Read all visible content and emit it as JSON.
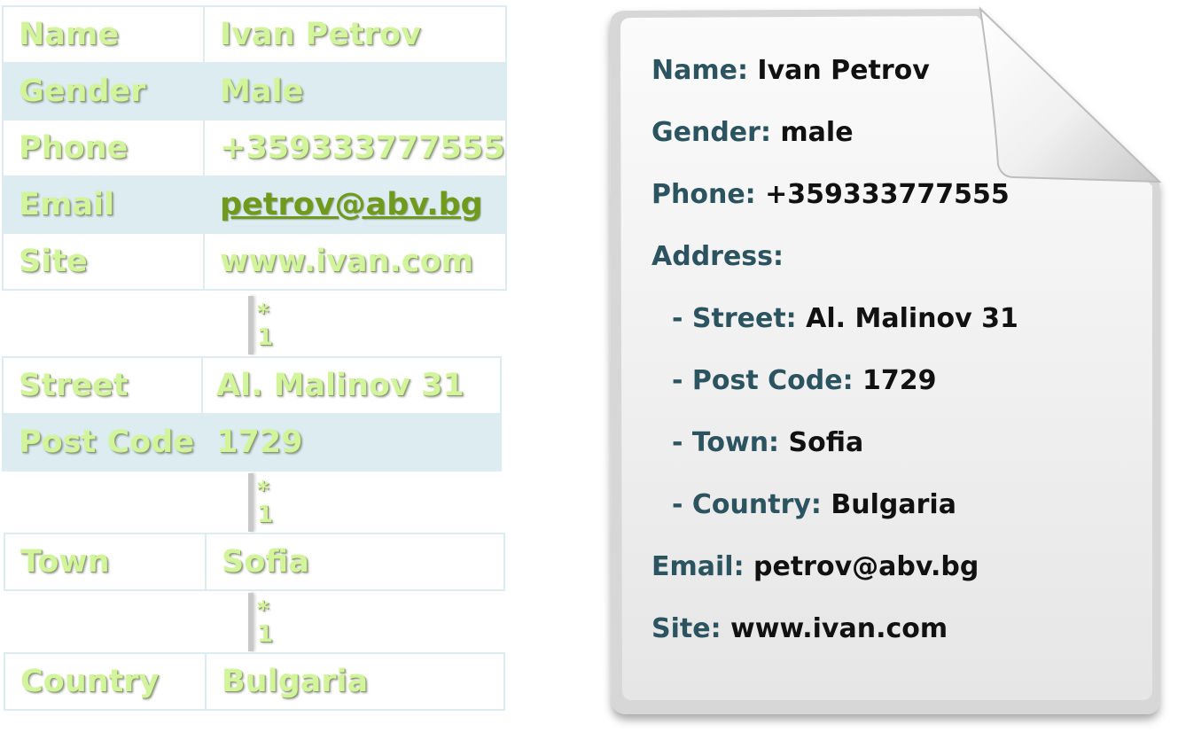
{
  "person": {
    "rows": [
      {
        "key": "Name",
        "value": "Ivan Petrov"
      },
      {
        "key": "Gender",
        "value": "Male"
      },
      {
        "key": "Phone",
        "value": "+359333777555"
      },
      {
        "key": "Email",
        "value": "petrov@abv.bg"
      },
      {
        "key": "Site",
        "value": "www.ivan.com"
      }
    ]
  },
  "address": {
    "rows": [
      {
        "key": "Street",
        "value": "Al. Malinov 31"
      },
      {
        "key": "Post Code",
        "value": "1729"
      }
    ]
  },
  "town": {
    "key": "Town",
    "value": "Sofia"
  },
  "country": {
    "key": "Country",
    "value": "Bulgaria"
  },
  "relations": {
    "many": "*",
    "one": "1"
  },
  "document": {
    "name_label": "Name:",
    "name_value": "Ivan Petrov",
    "gender_label": "Gender:",
    "gender_value": "male",
    "phone_label": "Phone:",
    "phone_value": "+359333777555",
    "address_label": "Address:",
    "street_label": "- Street:",
    "street_value": "Al. Malinov 31",
    "postcode_label": "- Post Code:",
    "postcode_value": "1729",
    "town_label": "- Town:",
    "town_value": "Sofia",
    "country_label": "- Country:",
    "country_value": "Bulgaria",
    "email_label": "Email:",
    "email_value": "petrov@abv.bg",
    "site_label": "Site:",
    "site_value": "www.ivan.com"
  },
  "colors": {
    "table_text": "#d2f59c",
    "table_alt_row": "#dcecf1",
    "doc_label": "#2b5460",
    "doc_value": "#111111"
  }
}
